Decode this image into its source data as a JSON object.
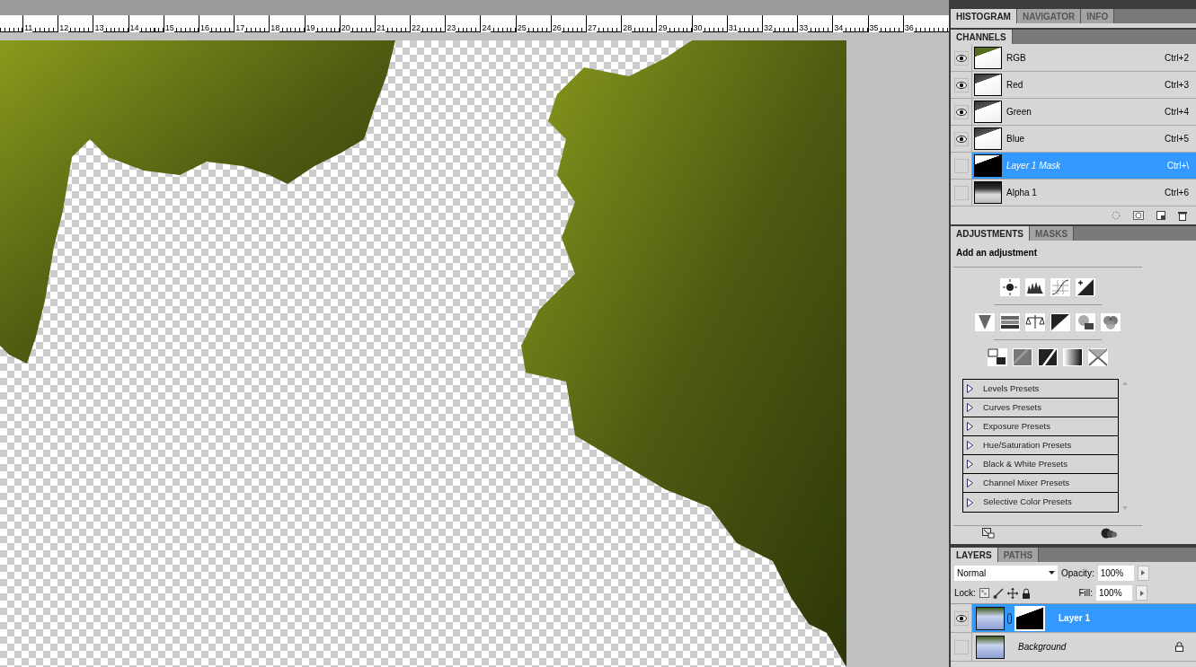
{
  "ruler": {
    "labels": [
      "11",
      "12",
      "13",
      "14",
      "15",
      "16",
      "17",
      "18",
      "19",
      "20",
      "21",
      "22",
      "23",
      "24",
      "25",
      "26",
      "27",
      "28",
      "29",
      "30",
      "31",
      "32",
      "33",
      "34",
      "35",
      "36"
    ]
  },
  "top_panel": {
    "tabs": [
      {
        "label": "HISTOGRAM",
        "selected": true
      },
      {
        "label": "NAVIGATOR",
        "selected": false
      },
      {
        "label": "INFO",
        "selected": false
      }
    ]
  },
  "channels": {
    "tabs": [
      {
        "label": "CHANNELS",
        "selected": true
      }
    ],
    "rows": [
      {
        "kind": "composite",
        "name": "RGB",
        "shortcut": "Ctrl+2",
        "visible": true,
        "selected": false
      },
      {
        "kind": "color",
        "name": "Red",
        "shortcut": "Ctrl+3",
        "visible": true,
        "selected": false
      },
      {
        "kind": "color",
        "name": "Green",
        "shortcut": "Ctrl+4",
        "visible": true,
        "selected": false
      },
      {
        "kind": "color",
        "name": "Blue",
        "shortcut": "Ctrl+5",
        "visible": true,
        "selected": false
      },
      {
        "kind": "mask",
        "name": "Layer 1 Mask",
        "shortcut": "Ctrl+\\",
        "visible": false,
        "selected": true
      },
      {
        "kind": "alpha",
        "name": "Alpha 1",
        "shortcut": "Ctrl+6",
        "visible": false,
        "selected": false
      }
    ]
  },
  "adjustments": {
    "tabs": [
      {
        "label": "ADJUSTMENTS",
        "selected": true
      },
      {
        "label": "MASKS",
        "selected": false
      }
    ],
    "heading": "Add an adjustment",
    "presets": [
      "Levels Presets",
      "Curves Presets",
      "Exposure Presets",
      "Hue/Saturation Presets",
      "Black & White Presets",
      "Channel Mixer Presets",
      "Selective Color Presets"
    ]
  },
  "layers": {
    "tabs": [
      {
        "label": "LAYERS",
        "selected": true
      },
      {
        "label": "PATHS",
        "selected": false
      }
    ],
    "blend_mode": "Normal",
    "opacity_label": "Opacity:",
    "opacity": "100%",
    "lock_label": "Lock:",
    "fill_label": "Fill:",
    "fill": "100%",
    "rows": [
      {
        "name": "Layer 1",
        "visible": true,
        "selected": true,
        "has_mask": true,
        "locked": false
      },
      {
        "name": "Background",
        "visible": false,
        "selected": false,
        "has_mask": false,
        "locked": true
      }
    ]
  }
}
